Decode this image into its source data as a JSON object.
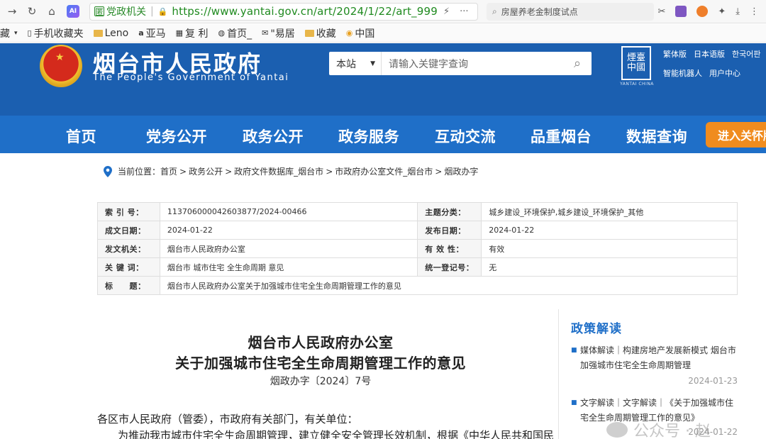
{
  "browser": {
    "gov_tag": "党政机关",
    "url": "https://www.yantai.gov.cn/art/2024/1/22/art_999",
    "search_query": "房屋养老金制度试点",
    "ai_label": "AI",
    "bookmarks": [
      {
        "label": "藏",
        "icon": "folder-icon"
      },
      {
        "label": "手机收藏夹",
        "icon": "phone-icon"
      },
      {
        "label": "Leno",
        "icon": "folder-icon"
      },
      {
        "label": "亚马",
        "icon": "amazon-icon"
      },
      {
        "label": "复 利",
        "icon": "grid-icon"
      },
      {
        "label": "首页_",
        "icon": "globe-icon"
      },
      {
        "label": "\"易居",
        "icon": "logo-icon"
      },
      {
        "label": "收藏",
        "icon": "folder-icon"
      },
      {
        "label": "中国",
        "icon": "circle-icon"
      }
    ]
  },
  "header": {
    "site_title": "烟台市人民政府",
    "site_subtitle": "The People's Government of Yantai",
    "search_scope": "本站",
    "search_placeholder": "请输入关键字查询",
    "logo_text": "煙臺中國",
    "logo_caption": "YANTAI CHINA",
    "links_row1": [
      "繁体版",
      "日本语版",
      "한국어판"
    ],
    "links_row2": [
      "智能机器人",
      "用户中心"
    ]
  },
  "nav": {
    "items": [
      "首页",
      "党务公开",
      "政务公开",
      "政务服务",
      "互动交流",
      "品重烟台",
      "数据查询"
    ],
    "special": "进入关怀版"
  },
  "breadcrumb": {
    "prefix": "当前位置：",
    "items": [
      "首页",
      "政务公开",
      "政府文件数据库_烟台市",
      "市政府办公室文件_烟台市",
      "烟政办字"
    ]
  },
  "info": {
    "index_label": "索 引 号：",
    "index_value": "113706000042603877/2024-00466",
    "category_label": "主题分类：",
    "category_value": "城乡建设_环境保护,城乡建设_环境保护_其他",
    "date_label": "成文日期：",
    "date_value": "2024-01-22",
    "publish_label": "发布日期：",
    "publish_value": "2024-01-22",
    "issuer_label": "发文机关：",
    "issuer_value": "烟台市人民政府办公室",
    "validity_label": "有 效 性：",
    "validity_value": "有效",
    "keywords_label": "关 键 词：",
    "keywords_value": "烟台市 城市住宅 全生命周期 意见",
    "regnum_label": "统一登记号：",
    "regnum_value": "无",
    "subject_label": "标　　题：",
    "subject_value": "烟台市人民政府办公室关于加强城市住宅全生命周期管理工作的意见"
  },
  "article": {
    "title_line1": "烟台市人民政府办公室",
    "title_line2": "关于加强城市住宅全生命周期管理工作的意见",
    "doc_number": "烟政办字〔2024〕7号",
    "recipients": "各区市人民政府（管委），市政府有关部门，有关单位：",
    "body_line1": "为推动我市城市住宅全生命周期管理，建立健全安全管理长效机制，根据《中华人民共和国民"
  },
  "sidebar": {
    "title": "政策解读",
    "items": [
      {
        "text": "媒体解读｜构建房地产发展新模式 烟台市加强城市住宅全生命周期管理",
        "date": "2024-01-23"
      },
      {
        "text": "文字解读｜文字解读｜《关于加强城市住宅全生命周期管理工作的意见》",
        "date": "2024-01-22"
      }
    ]
  },
  "watermark": "公众号 · 赵"
}
